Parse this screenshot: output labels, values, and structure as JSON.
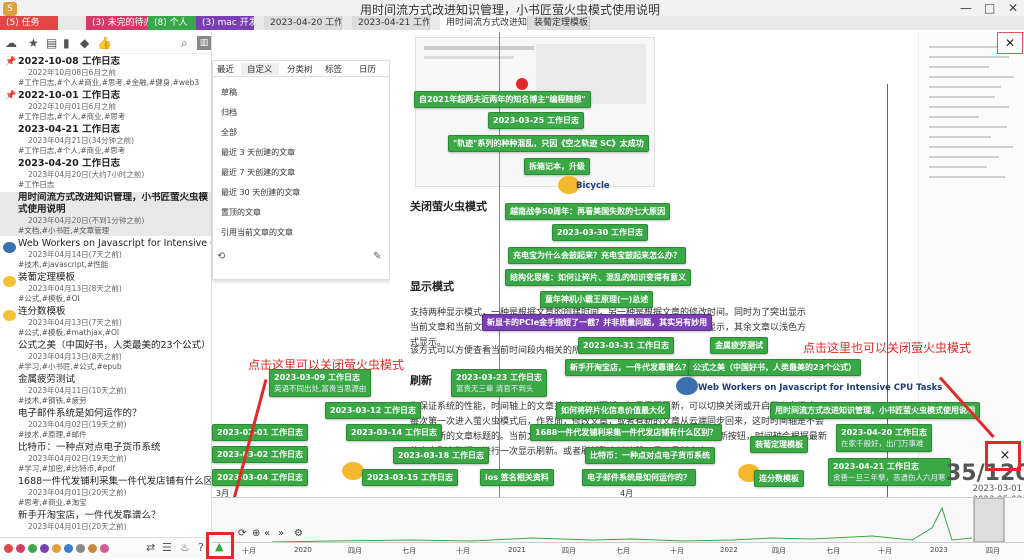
{
  "window": {
    "title": "用时间流方式改进知识管理，小书匠萤火虫模式使用说明",
    "controls": [
      "—",
      "□",
      "✕"
    ],
    "app_icon": "S"
  },
  "tabs": [
    {
      "label": "(5) 任务",
      "color": "#e04848"
    },
    {
      "label": "(3) 未完的待办",
      "color": "#d33a6a"
    },
    {
      "label": "(8) 个人",
      "color": "#3aa84a"
    },
    {
      "label": "(3) mac 开发",
      "color": "#7b3fb5"
    },
    {
      "label": "2023-04-20 工作日志",
      "color": ""
    },
    {
      "label": "2023-04-21 工作日志",
      "color": ""
    },
    {
      "label": "用时间流方式改进知识管理",
      "color": ""
    },
    {
      "label": "装葡定理模板",
      "color": ""
    }
  ],
  "sidebar": {
    "notes": [
      {
        "title": "2022-10-08 工作日志",
        "meta": "2022年10月08日6月之前",
        "tags": "#工作日志,#个人#商业,#思考,#金融,#健身,#web3",
        "pinned": true
      },
      {
        "title": "2022-10-01 工作日志",
        "meta": "2022年10月01日6月之前",
        "tags": "#工作日志,#个人,#商业,#思考",
        "pinned": true
      },
      {
        "title": "2023-04-21 工作日志",
        "meta": "2023年04月21日(34分钟之前)",
        "tags": "#工作日志,#个人,#商业,#思考",
        "pinned": false
      },
      {
        "title": "2023-04-20 工作日志",
        "meta": "2023年04月20日(大约7小时之前)",
        "tags": "#工作日志",
        "pinned": false
      },
      {
        "title": "用时间流方式改进知识管理，小书匠萤火虫模式使用说明",
        "meta": "2023年04月20日(不到1分钟之前)",
        "tags": "#文档,#小书匠,#文章管理",
        "pinned": false,
        "selected": true
      },
      {
        "title": "Web Workers on Javascript for Intensive CPU Tasks",
        "meta": "2023年04月14日(7天之前)",
        "tags": "#技术,#javascript,#性能",
        "pinned": false
      },
      {
        "title": "装葡定理模板",
        "meta": "2023年04月13日(8天之前)",
        "tags": "#公式,#模板,#OI",
        "pinned": false
      },
      {
        "title": "连分数模板",
        "meta": "2023年04月13日(7天之前)",
        "tags": "#公式,#模板,#mathjax,#OI",
        "pinned": false
      },
      {
        "title": "公式之美（中国好书，人类最美的23个公式）",
        "meta": "2023年04月13日(8天之前)",
        "tags": "#学习,#小书匠,#公式,#epub",
        "pinned": false
      },
      {
        "title": "金属疲劳测试",
        "meta": "2023年04月11日(10天之前)",
        "tags": "#技术,#钢铁,#疲劳",
        "pinned": false
      },
      {
        "title": "电子邮件系统是如何运作的？",
        "meta": "2023年04月02日(19天之前)",
        "tags": "#技术,#原理,#邮件",
        "pinned": false
      },
      {
        "title": "比特币：一种点对点电子货币系统",
        "meta": "2023年04月02日(19天之前)",
        "tags": "#学习,#加密,#比特币,#pdf",
        "pinned": false
      },
      {
        "title": "1688一件代发铺利采集一件代发店铺有什么区别？",
        "meta": "2023年04月01日(20天之前)",
        "tags": "#思考,#商业,#淘宝",
        "pinned": false
      },
      {
        "title": "新手开淘宝店，一件代发靠谱么？",
        "meta": "2023年04月01日(20天之前)",
        "tags": "",
        "pinned": false
      }
    ]
  },
  "context_menu": {
    "tabs": [
      "最近",
      "自定义",
      "分类树",
      "标签",
      "日历"
    ],
    "items": [
      "草稿",
      "归档",
      "全部",
      "最近 3 天创建的文章",
      "最近 7 天创建的文章",
      "最近 30 天创建的文章",
      "置顶的文章",
      "引用当前文章的文章"
    ]
  },
  "content": {
    "heading_close": "关闭萤火虫模式",
    "heading_display": "显示模式",
    "para1": "支持两种显示模式，一种是根据文章的创建时间，另一种是根据文章的修改时间。同时为了突出显示当前文章和当前文章列表显示的文章。当前文章列表中的文章将以绿色方式显示，其余文章以浅色方式显示。",
    "para2": "该方式可以方便查看当前时间段内相关的所有文章。",
    "heading_refresh": "刷新",
    "para3": "为保证系统的性能，时间轴上的文章并不会实时更新。如果需要更新，可以切换关闭或开启萤火虫模式。每次第一次进入萤火虫模式后，作界面，修改文章，或者有新的文章从云端同步回来，这时时间轴是不会显示最新的文章标题的。当前文章列表时间轴 里的，需要用户自己主动点击刷新按钮，时间轴会根据最新的文章列表数据，进行一次显示刷新。或者刷新整个过滤器，显示最新文章。"
  },
  "annotations": {
    "left": "点击这里可以关闭萤火虫模式",
    "right": "点击这里也可以关闭萤火虫模式"
  },
  "timeline": {
    "cards": [
      {
        "text": "自2021年起两夫近两年的知名博主\"编程随想\"",
        "color": "green"
      },
      {
        "text": "2023-03-25 工作日志",
        "color": "green"
      },
      {
        "text": "\"轨迹\"系列的种种混乱，只因《空之轨迹 SC》太成功",
        "color": "green"
      },
      {
        "text": "拆箱记本，升级",
        "color": "green"
      },
      {
        "text": "Bicycle",
        "color": "label"
      },
      {
        "text": "越南战争50周年：再看美国失败的七大原因",
        "color": "green"
      },
      {
        "text": "2023-03-30 工作日志",
        "color": "green"
      },
      {
        "text": "充电宝为什么会鼓起来？充电宝鼓起来怎么办？",
        "color": "green"
      },
      {
        "text": "结构化思维：如何让碎片、混乱的知识变得有意义",
        "color": "green"
      },
      {
        "text": "童年神机小霸王原理(一)总述",
        "color": "green"
      },
      {
        "text": "新显卡的PCIe金手指短了一截？并非质量问题，其实另有妙用",
        "color": "purple"
      },
      {
        "text": "2023-03-31 工作日志",
        "color": "green"
      },
      {
        "text": "金属疲劳测试",
        "color": "green"
      },
      {
        "text": "新手开淘宝店，一件代发靠谱么？",
        "color": "green"
      },
      {
        "text": "公式之美（中国好书，人类最美的23个公式）",
        "color": "green"
      },
      {
        "text": "2023-03-09 工作日志",
        "sub": "英语不同出处,富贵当思源由",
        "color": "green"
      },
      {
        "text": "2023-03-23 工作日志",
        "sub": "富贵无三辈 清官不到头",
        "color": "green"
      },
      {
        "text": "Web Workers on Javascript for Intensive CPU Tasks",
        "color": "label"
      },
      {
        "text": "2023-03-12 工作日志",
        "color": "green"
      },
      {
        "text": "如何将碎片化信息价值最大化",
        "color": "green"
      },
      {
        "text": "用时间流方式改进知识管理，小书匠萤火虫模式使用说明",
        "color": "green"
      },
      {
        "text": "2023-03-14 工作日志",
        "color": "green"
      },
      {
        "text": "1688一件代发铺利采集一件代发店铺有什么区别？",
        "color": "green"
      },
      {
        "text": "装葡定理模板",
        "color": "green"
      },
      {
        "text": "2023-04-20 工作日志",
        "sub": "在家千般好，出门万事难",
        "color": "green"
      },
      {
        "text": "2023-02-01 工作日志",
        "color": "green"
      },
      {
        "text": "2023-03-02 工作日志",
        "color": "green"
      },
      {
        "text": "2023-03-18 工作日志",
        "color": "green"
      },
      {
        "text": "比特币：一种点对点电子货币系统",
        "color": "green"
      },
      {
        "text": "2023-04-21 工作日志",
        "sub": "贪善一旦三年孽，恶遗伤人六月寒",
        "color": "green"
      },
      {
        "text": "2023-03-04 工作日志",
        "color": "green"
      },
      {
        "text": "2023-03-15 工作日志",
        "color": "green"
      },
      {
        "text": "ios 签名相关资料",
        "color": "green"
      },
      {
        "text": "电子邮件系统是如何运作的？",
        "color": "green"
      },
      {
        "text": "连分数模板",
        "color": "green"
      }
    ],
    "months_top": [
      "3月",
      "4月"
    ],
    "axis_ticks": [
      "十月",
      "2020",
      "四月",
      "七月",
      "十月",
      "2021",
      "四月",
      "七月",
      "十月",
      "2022",
      "四月",
      "七月",
      "十月",
      "2023",
      "四月"
    ],
    "counter": "35/120",
    "counter_dates": [
      "2023-03-01",
      "2023-05-02"
    ],
    "close_symbol": "×"
  },
  "sidebar_bottom": {
    "dot_colors": [
      "#e04848",
      "#d33a6a",
      "#3aa84a",
      "#7b3fb5",
      "#e0a13a",
      "#3a7fd3",
      "#888",
      "#c98a3a",
      "#d35a9a"
    ]
  }
}
